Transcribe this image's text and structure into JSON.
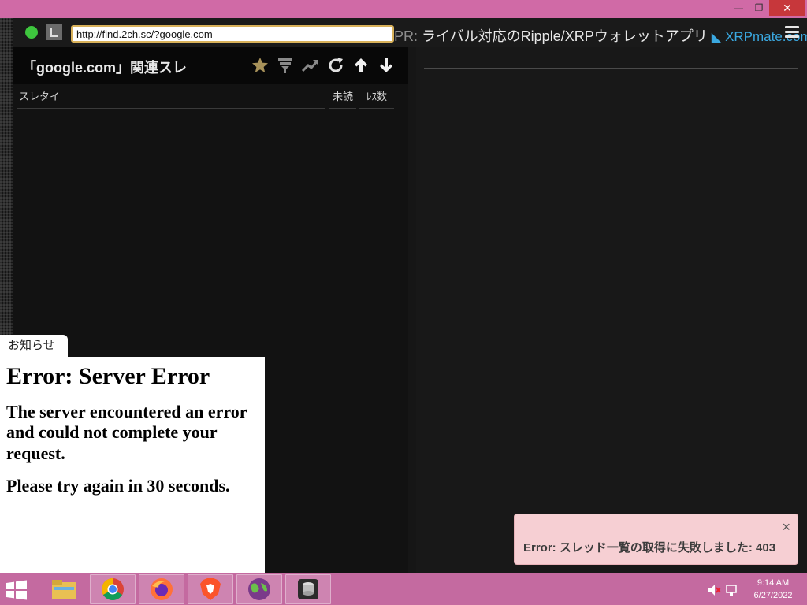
{
  "window": {
    "minimize_icon": "minimize-icon",
    "maximize_icon": "restore-icon",
    "close_icon": "close-icon"
  },
  "toolbar": {
    "status_icon": "status-dot-icon",
    "clock_icon": "clock-icon",
    "url_value": "http://find.2ch.sc/?google.com",
    "ad_prefix": "PR:",
    "ad_text": "ライバル対応のRipple/XRPウォレットアプリ",
    "ad_site": "XRPmate.com",
    "menu_icon": "hamburger-menu-icon"
  },
  "thread_list": {
    "title": "「google.com」関連スレ",
    "tools": [
      "star-icon",
      "filter-icon",
      "trend-icon",
      "refresh-icon",
      "arrow-up-icon",
      "arrow-down-icon"
    ],
    "columns": {
      "title": "スレタイ",
      "unread": "未読",
      "res_count": "ﾚｽ数"
    }
  },
  "notice": {
    "tab_label": "お知らせ",
    "heading": "Error: Server Error",
    "message": "The server encountered an error and could not complete your request.",
    "retry": "Please try again in 30 seconds."
  },
  "toast": {
    "message": "Error: スレッド一覧の取得に失敗しました: 403",
    "close_symbol": "×"
  },
  "taskbar": {
    "apps": [
      "file-explorer-icon",
      "chrome-icon",
      "firefox-icon",
      "brave-icon",
      "globe-app-icon",
      "database-app-icon"
    ],
    "time": "9:14 AM",
    "date": "6/27/2022"
  },
  "colors": {
    "accent_url_border": "#d8b15a",
    "status_green": "#3ec63e",
    "toast_bg": "#f6cfd3",
    "titlebar": "#d06aa6"
  }
}
